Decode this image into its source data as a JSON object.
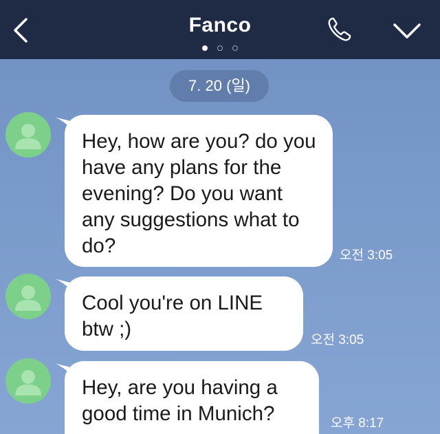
{
  "header": {
    "title": "Fanco",
    "page_dots": {
      "count": 3,
      "active_index": 0
    }
  },
  "date_separator": "7. 20 (일)",
  "messages": [
    {
      "text": "Hey, how are you? do you have any plans for the evening? Do you want any suggestions what to do?",
      "time": "오전 3:05"
    },
    {
      "text": "Cool you're on LINE btw ;)",
      "time": "오전 3:05"
    },
    {
      "text": "Hey, are you having a good time in Munich?",
      "time": "오후 8:17"
    }
  ],
  "colors": {
    "header_bg": "#1f2a44",
    "chat_bg": "#7a9acb",
    "avatar_bg": "#7dd08a",
    "bubble_bg": "#ffffff"
  },
  "icons": [
    "back-icon",
    "call-icon",
    "chevron-down-icon",
    "avatar-person-icon"
  ]
}
